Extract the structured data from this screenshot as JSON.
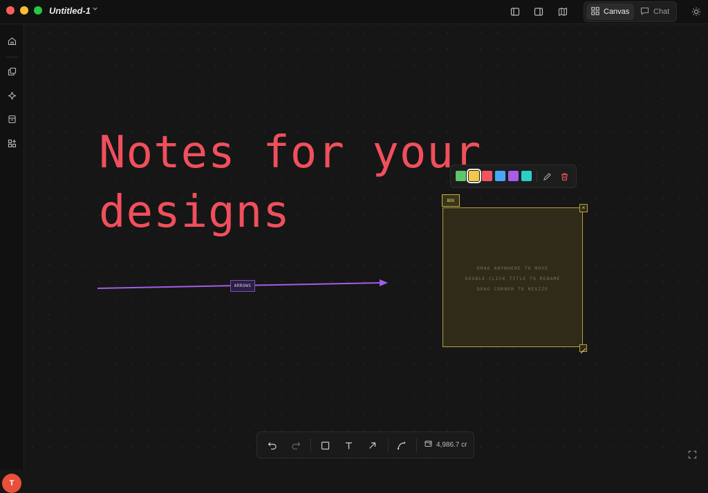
{
  "window": {
    "title": "Untitled-1",
    "traffic_colors": [
      "#fe5f57",
      "#febc2e",
      "#28c840"
    ]
  },
  "header": {
    "icons": [
      "sidebar-left-icon",
      "sidebar-right-icon",
      "map-icon",
      "sun-icon"
    ],
    "mode_tabs": [
      {
        "label": "Canvas",
        "icon": "grid-icon",
        "active": true
      },
      {
        "label": "Chat",
        "icon": "chat-icon",
        "active": false
      }
    ]
  },
  "sidebar": {
    "items": [
      "home-icon",
      "copy-icon",
      "sparkle-icon",
      "archive-icon",
      "apps-add-icon"
    ],
    "avatar_initial": "T"
  },
  "canvas": {
    "headline": "Notes for your\ndesigns",
    "headline_color": "#f04f5c",
    "arrow": {
      "label": "ARROWS",
      "color": "#a45ee8"
    },
    "color_picker": {
      "swatches": [
        "#5dc76a",
        "#f2c94c",
        "#ef5662",
        "#4aa6f2",
        "#a45ee8",
        "#2ad0c7"
      ],
      "selected_index": 1,
      "actions": [
        "pencil-icon",
        "trash-icon"
      ]
    },
    "box": {
      "tag": "BOX",
      "hints": [
        "DRAG ANYWHERE TO MOVE",
        "DOUBLE-CLICK TITLE TO RENAME",
        "DRAG CORNER TO RESIZE"
      ],
      "close_glyph": "×"
    }
  },
  "toolbar": {
    "tools": [
      "undo-icon",
      "redo-icon",
      "rectangle-icon",
      "text-icon",
      "arrow-icon",
      "curve-icon"
    ],
    "credits": "4,986.7 cr"
  }
}
